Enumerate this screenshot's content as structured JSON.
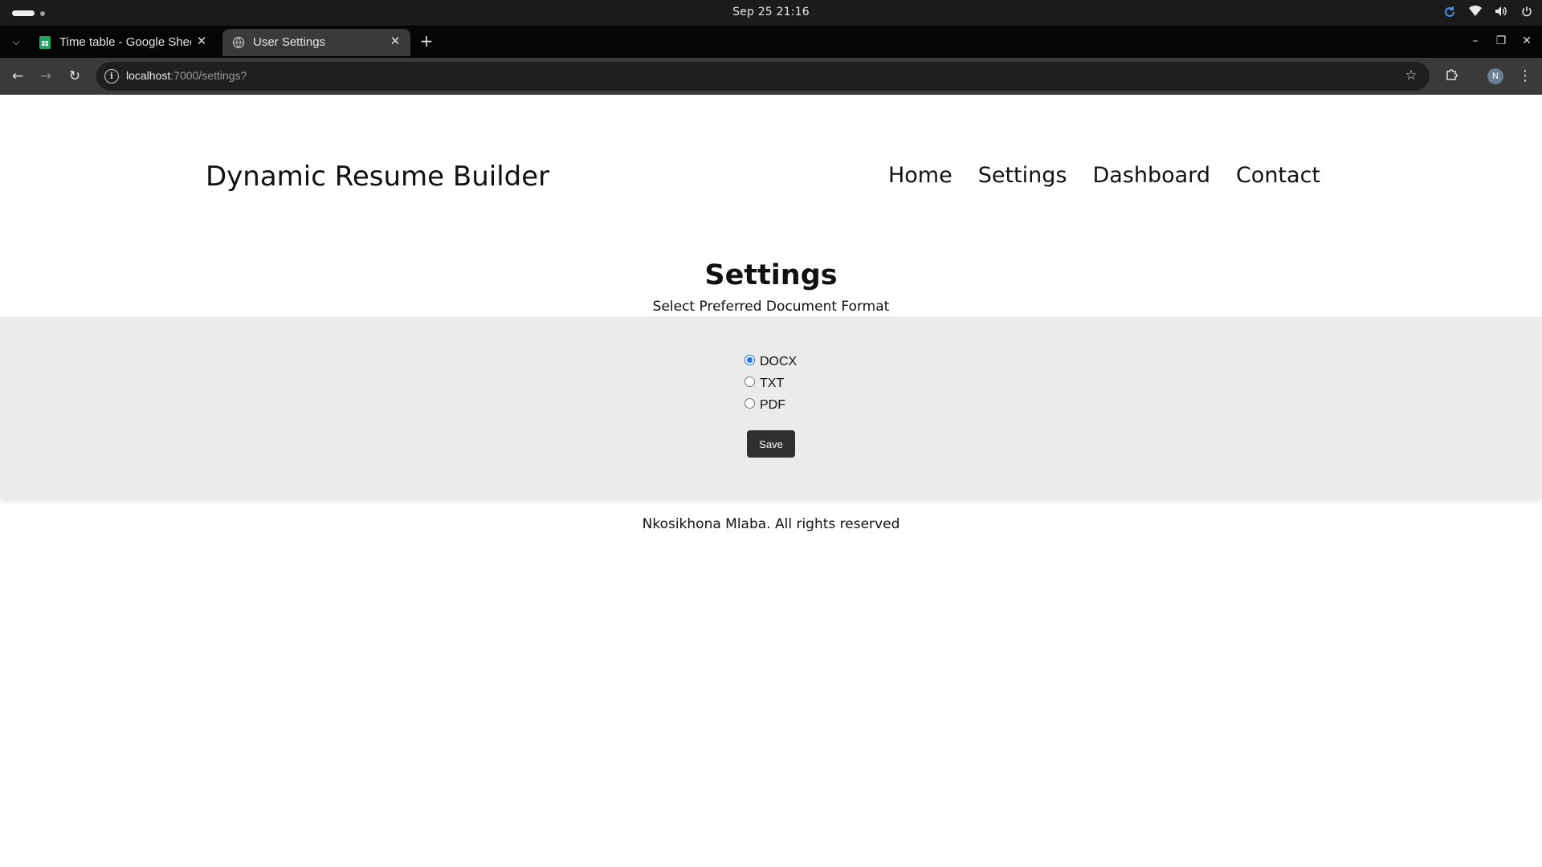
{
  "os_bar": {
    "clock": "Sep 25  21:16",
    "icons": [
      "refresh-icon",
      "wifi-icon",
      "volume-icon",
      "power-icon"
    ]
  },
  "browser": {
    "tabs": [
      {
        "title": "Time table - Google Sheets",
        "favicon": "sheets-icon",
        "active": false
      },
      {
        "title": "User Settings",
        "favicon": "globe-icon",
        "active": true
      }
    ],
    "url_host": "localhost",
    "url_rest": ":7000/settings?",
    "profile_initial": "N",
    "colors": {
      "tabstrip": "#050505",
      "toolbar": "#3a3a3a",
      "omnibox": "#1f1f1f"
    }
  },
  "site": {
    "logo": "Dynamic Resume Builder",
    "nav": [
      "Home",
      "Settings",
      "Dashboard",
      "Contact"
    ]
  },
  "settings": {
    "title": "Settings",
    "subtitle": "Select Preferred Document Format",
    "options": [
      {
        "label": "DOCX",
        "checked": true
      },
      {
        "label": "TXT",
        "checked": false
      },
      {
        "label": "PDF",
        "checked": false
      }
    ],
    "save_label": "Save",
    "panel_color": "#ebebeb",
    "button_color": "#2f2f2f",
    "accent": "#1a73e8"
  },
  "footer": {
    "text": "Nkosikhona Mlaba. All rights reserved"
  }
}
